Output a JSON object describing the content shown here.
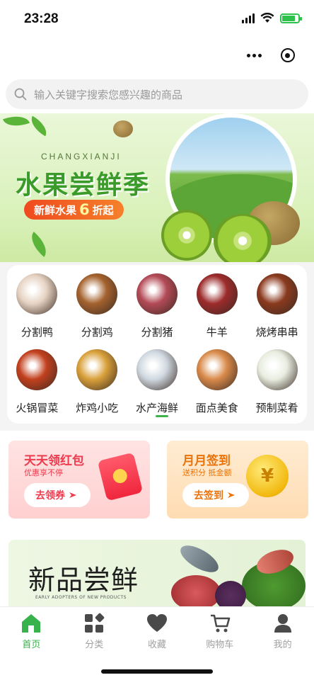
{
  "status_bar": {
    "time": "23:28"
  },
  "search": {
    "placeholder": "输入关键字搜索您感兴趣的商品"
  },
  "banner": {
    "subtitle": "CHANGXIANJI",
    "title": "水果尝鲜季",
    "pill_prefix": "新鲜水果",
    "pill_number": "6",
    "pill_suffix": "折起"
  },
  "categories": [
    {
      "label": "分割鸭",
      "color": "#e6d3c3"
    },
    {
      "label": "分割鸡",
      "color": "#a4622e"
    },
    {
      "label": "分割猪",
      "color": "#b34a56"
    },
    {
      "label": "牛羊",
      "color": "#9c2b2b"
    },
    {
      "label": "烧烤串串",
      "color": "#8a3a1e"
    },
    {
      "label": "火锅冒菜",
      "color": "#c2401d"
    },
    {
      "label": "炸鸡小吃",
      "color": "#d9a03a"
    },
    {
      "label": "水产海鲜",
      "color": "#cfd8e0"
    },
    {
      "label": "面点美食",
      "color": "#d98a4a"
    },
    {
      "label": "预制菜肴",
      "color": "#e8ede0"
    }
  ],
  "promos": {
    "red": {
      "title": "天天领红包",
      "subtitle": "优惠享不停",
      "button": "去领券"
    },
    "orange": {
      "title": "月月签到",
      "subtitle": "送积分 抵金额",
      "button": "去签到",
      "coin_glyph": "¥"
    }
  },
  "new_products": {
    "title": "新品尝鲜",
    "subtitle": "EARLY ADOPTERS OF NEW PRODUCTS"
  },
  "tabs": [
    {
      "label": "首页",
      "icon": "home-icon",
      "active": true
    },
    {
      "label": "分类",
      "icon": "category-icon",
      "active": false
    },
    {
      "label": "收藏",
      "icon": "heart-icon",
      "active": false
    },
    {
      "label": "购物车",
      "icon": "cart-icon",
      "active": false
    },
    {
      "label": "我的",
      "icon": "user-icon",
      "active": false
    }
  ],
  "colors": {
    "accent": "#38b24a",
    "inactive": "#a0a0a0",
    "red": "#ee3b4e",
    "orange": "#e9730a"
  }
}
